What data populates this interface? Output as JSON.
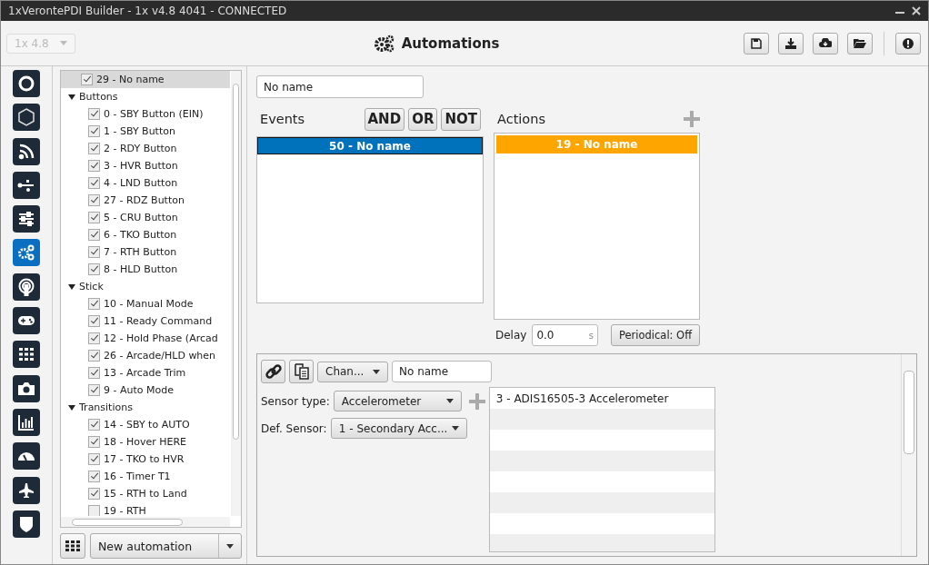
{
  "window": {
    "title": "1xVerontePDI Builder - 1x v4.8 4041 - CONNECTED"
  },
  "header": {
    "version": "1x 4.8",
    "title": "Automations"
  },
  "nav": [
    {
      "selected": false
    },
    {
      "selected": false
    },
    {
      "selected": false
    },
    {
      "selected": false
    },
    {
      "selected": false
    },
    {
      "selected": true
    },
    {
      "selected": false
    },
    {
      "selected": false
    },
    {
      "selected": false
    },
    {
      "selected": false
    },
    {
      "selected": false
    },
    {
      "selected": false
    },
    {
      "selected": false
    },
    {
      "selected": false
    }
  ],
  "tree": {
    "items": [
      {
        "label": "29 - No name",
        "checked": true,
        "selected": true
      },
      {
        "label": "Buttons",
        "expanded": true,
        "children": [
          {
            "label": "0 - SBY Button (EIN)",
            "checked": true,
            "selected": false
          },
          {
            "label": "1 - SBY Button",
            "checked": true,
            "selected": false
          },
          {
            "label": "2 - RDY Button",
            "checked": true,
            "selected": false
          },
          {
            "label": "3 - HVR Button",
            "checked": true,
            "selected": false
          },
          {
            "label": "4 - LND Button",
            "checked": true,
            "selected": false
          },
          {
            "label": "27 - RDZ Button",
            "checked": true,
            "selected": false
          },
          {
            "label": "5 - CRU Button",
            "checked": true,
            "selected": false
          },
          {
            "label": "6 - TKO Button",
            "checked": true,
            "selected": false
          },
          {
            "label": "7 - RTH Button",
            "checked": true,
            "selected": false
          },
          {
            "label": "8 - HLD Button",
            "checked": true,
            "selected": false
          }
        ]
      },
      {
        "label": "Stick",
        "expanded": true,
        "children": [
          {
            "label": "10 - Manual Mode",
            "checked": true,
            "selected": false
          },
          {
            "label": "11 - Ready Command",
            "checked": true,
            "selected": false
          },
          {
            "label": "12 - Hold Phase (Arcad",
            "checked": true,
            "selected": false
          },
          {
            "label": "26 - Arcade/HLD when",
            "checked": true,
            "selected": false
          },
          {
            "label": "13 - Arcade Trim",
            "checked": true,
            "selected": false
          },
          {
            "label": "9 - Auto Mode",
            "checked": true,
            "selected": false
          }
        ]
      },
      {
        "label": "Transitions",
        "expanded": true,
        "children": [
          {
            "label": "14 - SBY to AUTO",
            "checked": true,
            "selected": false
          },
          {
            "label": "18 - Hover HERE",
            "checked": true,
            "selected": false
          },
          {
            "label": "17 - TKO to HVR",
            "checked": true,
            "selected": false
          },
          {
            "label": "16 - Timer T1",
            "checked": true,
            "selected": false
          },
          {
            "label": "15 - RTH to Land",
            "checked": true,
            "selected": false
          },
          {
            "label": "19 - RTH",
            "checked": false,
            "selected": false
          }
        ]
      }
    ]
  },
  "new_automation": {
    "value": "New automation"
  },
  "automation_name": {
    "value": "No name"
  },
  "events": {
    "title": "Events",
    "operators": [
      "AND",
      "OR",
      "NOT"
    ],
    "items": [
      {
        "label": "50 - No name",
        "selected": true
      }
    ]
  },
  "actions": {
    "title": "Actions",
    "items": [
      {
        "label": "19 - No name",
        "color": "#ffa500"
      }
    ]
  },
  "delay": {
    "label": "Delay",
    "value": "0.0",
    "unit": "s"
  },
  "periodical": {
    "label": "Periodical: Off"
  },
  "action_detail": {
    "channel": "Chan...",
    "name": "No name",
    "sensor_type_label": "Sensor type:",
    "sensor_type": "Accelerometer",
    "def_sensor_label": "Def. Sensor:",
    "def_sensor": "1 - Secondary Acc...",
    "sensors": [
      "3 - ADIS16505-3 Accelerometer"
    ]
  }
}
